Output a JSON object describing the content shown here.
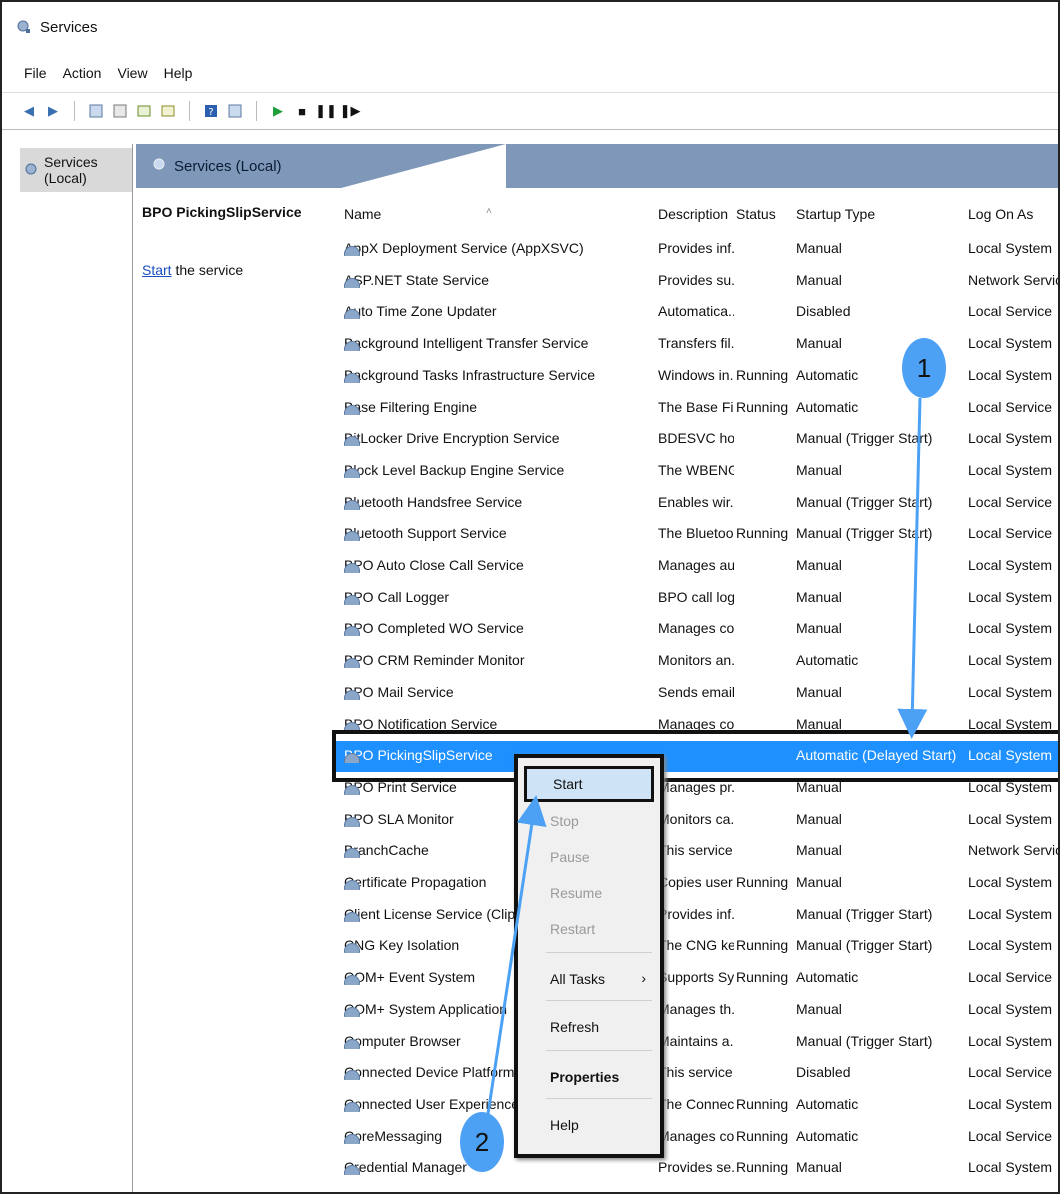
{
  "window": {
    "title": "Services"
  },
  "menubar": [
    "File",
    "Action",
    "View",
    "Help"
  ],
  "toolbar_icons": [
    "back-icon",
    "forward-icon",
    "up-icon",
    "show-hide-console-icon",
    "properties-icon",
    "export-icon",
    "help-icon",
    "mmc-icon",
    "play-icon",
    "stop-icon",
    "pause-icon",
    "restart-icon"
  ],
  "tree": {
    "root": "Services (Local)"
  },
  "header": {
    "title": "Services (Local)"
  },
  "detail": {
    "service_name": "BPO PickingSlipService",
    "start_link": "Start",
    "start_suffix": " the service"
  },
  "columns": {
    "name": "Name",
    "description": "Description",
    "status": "Status",
    "startup_type": "Startup Type",
    "log_on_as": "Log On As"
  },
  "services": [
    {
      "name": "AppX Deployment Service (AppXSVC)",
      "description": "Provides inf...",
      "status": "",
      "startup": "Manual",
      "logon": "Local System"
    },
    {
      "name": "ASP.NET State Service",
      "description": "Provides su...",
      "status": "",
      "startup": "Manual",
      "logon": "Network Service"
    },
    {
      "name": "Auto Time Zone Updater",
      "description": "Automatica...",
      "status": "",
      "startup": "Disabled",
      "logon": "Local Service"
    },
    {
      "name": "Background Intelligent Transfer Service",
      "description": "Transfers fil...",
      "status": "",
      "startup": "Manual",
      "logon": "Local System"
    },
    {
      "name": "Background Tasks Infrastructure Service",
      "description": "Windows in...",
      "status": "Running",
      "startup": "Automatic",
      "logon": "Local System"
    },
    {
      "name": "Base Filtering Engine",
      "description": "The Base Fil...",
      "status": "Running",
      "startup": "Automatic",
      "logon": "Local Service"
    },
    {
      "name": "BitLocker Drive Encryption Service",
      "description": "BDESVC hos...",
      "status": "",
      "startup": "Manual (Trigger Start)",
      "logon": "Local System"
    },
    {
      "name": "Block Level Backup Engine Service",
      "description": "The WBENG...",
      "status": "",
      "startup": "Manual",
      "logon": "Local System"
    },
    {
      "name": "Bluetooth Handsfree Service",
      "description": "Enables wir...",
      "status": "",
      "startup": "Manual (Trigger Start)",
      "logon": "Local Service"
    },
    {
      "name": "Bluetooth Support Service",
      "description": "The Bluetoo...",
      "status": "Running",
      "startup": "Manual (Trigger Start)",
      "logon": "Local Service"
    },
    {
      "name": "BPO Auto Close Call Service",
      "description": "Manages au...",
      "status": "",
      "startup": "Manual",
      "logon": "Local System"
    },
    {
      "name": "BPO Call Logger",
      "description": "BPO call log...",
      "status": "",
      "startup": "Manual",
      "logon": "Local System"
    },
    {
      "name": "BPO Completed WO Service",
      "description": "Manages co...",
      "status": "",
      "startup": "Manual",
      "logon": "Local System"
    },
    {
      "name": "BPO CRM Reminder Monitor",
      "description": "Monitors an...",
      "status": "",
      "startup": "Automatic",
      "logon": "Local System"
    },
    {
      "name": "BPO Mail Service",
      "description": "Sends email...",
      "status": "",
      "startup": "Manual",
      "logon": "Local System"
    },
    {
      "name": "BPO Notification Service",
      "description": "Manages co...",
      "status": "",
      "startup": "Manual",
      "logon": "Local System"
    },
    {
      "name": "BPO PickingSlipService",
      "description": "",
      "status": "",
      "startup": "Automatic (Delayed Start)",
      "logon": "Local System",
      "selected": true
    },
    {
      "name": "BPO Print Service",
      "description": "Manages pr...",
      "status": "",
      "startup": "Manual",
      "logon": "Local System"
    },
    {
      "name": "BPO SLA Monitor",
      "description": "Monitors ca...",
      "status": "",
      "startup": "Manual",
      "logon": "Local System"
    },
    {
      "name": "BranchCache",
      "description": "This service ...",
      "status": "",
      "startup": "Manual",
      "logon": "Network Service"
    },
    {
      "name": "Certificate Propagation",
      "description": "Copies user ...",
      "status": "Running",
      "startup": "Manual",
      "logon": "Local System"
    },
    {
      "name": "Client License Service (ClipSVC)",
      "description": "Provides inf...",
      "status": "",
      "startup": "Manual (Trigger Start)",
      "logon": "Local System"
    },
    {
      "name": "CNG Key Isolation",
      "description": "The CNG ke...",
      "status": "Running",
      "startup": "Manual (Trigger Start)",
      "logon": "Local System"
    },
    {
      "name": "COM+ Event System",
      "description": "Supports Sy...",
      "status": "Running",
      "startup": "Automatic",
      "logon": "Local Service"
    },
    {
      "name": "COM+ System Application",
      "description": "Manages th...",
      "status": "",
      "startup": "Manual",
      "logon": "Local System"
    },
    {
      "name": "Computer Browser",
      "description": "Maintains a...",
      "status": "",
      "startup": "Manual (Trigger Start)",
      "logon": "Local System"
    },
    {
      "name": "Connected Device Platform Ser...",
      "description": "This service ...",
      "status": "",
      "startup": "Disabled",
      "logon": "Local Service"
    },
    {
      "name": "Connected User Experiences an...",
      "description": "The Connec...",
      "status": "Running",
      "startup": "Automatic",
      "logon": "Local System"
    },
    {
      "name": "CoreMessaging",
      "description": "Manages co...",
      "status": "Running",
      "startup": "Automatic",
      "logon": "Local Service"
    },
    {
      "name": "Credential Manager",
      "description": "Provides se...",
      "status": "Running",
      "startup": "Manual",
      "logon": "Local System"
    }
  ],
  "context_menu": {
    "items": [
      {
        "label": "Start",
        "enabled": true,
        "highlighted": true
      },
      {
        "label": "Stop",
        "enabled": false
      },
      {
        "label": "Pause",
        "enabled": false
      },
      {
        "label": "Resume",
        "enabled": false
      },
      {
        "label": "Restart",
        "enabled": false
      },
      {
        "label": "All Tasks",
        "enabled": true,
        "submenu": true
      },
      {
        "label": "Refresh",
        "enabled": true
      },
      {
        "label": "Properties",
        "enabled": true,
        "bold": true
      },
      {
        "label": "Help",
        "enabled": true
      }
    ]
  },
  "callouts": [
    {
      "label": "1"
    },
    {
      "label": "2"
    }
  ],
  "colors": {
    "selection": "#1e90ff",
    "header_band": "#7f97b8",
    "callout": "#4da1f5"
  }
}
